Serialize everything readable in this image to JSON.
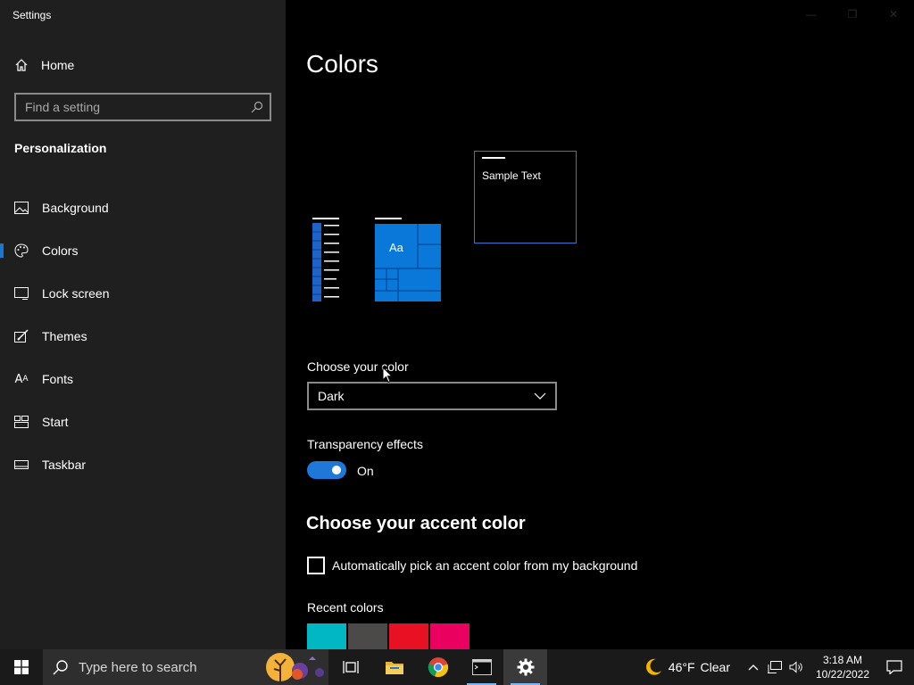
{
  "app": {
    "title": "Settings"
  },
  "sidebar": {
    "home_label": "Home",
    "search_placeholder": "Find a setting",
    "section_title": "Personalization",
    "items": [
      {
        "label": "Background",
        "icon": "image-icon"
      },
      {
        "label": "Colors",
        "icon": "palette-icon",
        "active": true
      },
      {
        "label": "Lock screen",
        "icon": "lock-screen-icon"
      },
      {
        "label": "Themes",
        "icon": "themes-brush-icon"
      },
      {
        "label": "Fonts",
        "icon": "fonts-icon"
      },
      {
        "label": "Start",
        "icon": "start-icon"
      },
      {
        "label": "Taskbar",
        "icon": "taskbar-icon"
      }
    ]
  },
  "main": {
    "title": "Colors",
    "preview": {
      "sample_text": "Sample Text",
      "tile_text": "Aa"
    },
    "choose_color": {
      "label": "Choose your color",
      "value": "Dark"
    },
    "transparency": {
      "label": "Transparency effects",
      "state": "On",
      "enabled": true
    },
    "accent": {
      "title": "Choose your accent color",
      "auto_pick_label": "Automatically pick an accent color from my background",
      "auto_pick_checked": false,
      "recent_label": "Recent colors",
      "recent_colors": [
        "#00b7c3",
        "#4c4a48",
        "#e81123",
        "#ea005e"
      ]
    }
  },
  "taskbar": {
    "search_placeholder": "Type here to search",
    "weather": {
      "temp": "46°F",
      "condition": "Clear"
    },
    "time": "3:18 AM",
    "date": "10/22/2022"
  },
  "colors": {
    "accent": "#0078d7",
    "sidebar_bg": "#1f1f1f",
    "main_bg": "#000000"
  }
}
